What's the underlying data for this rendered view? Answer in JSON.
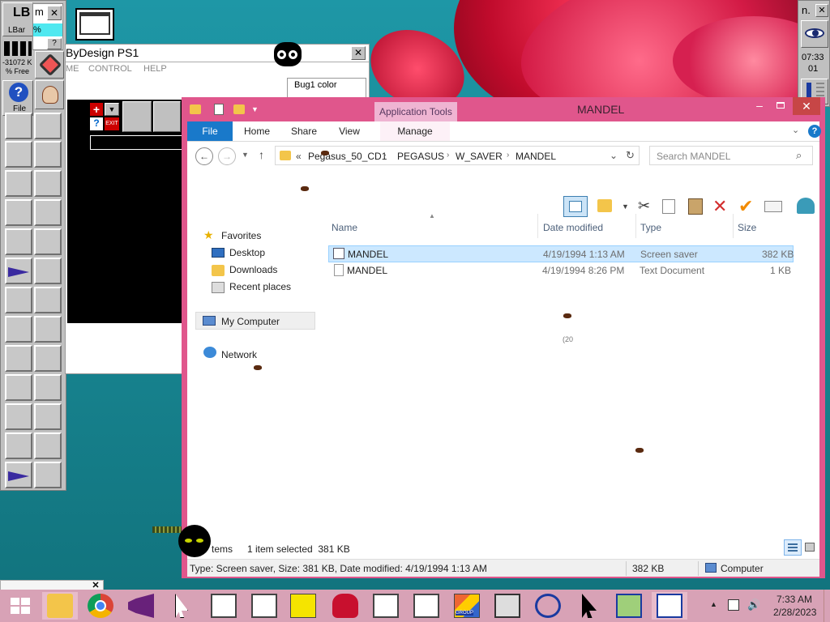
{
  "lbar": {
    "title": "LBar",
    "mem": "-31072 K",
    "free": "% Free",
    "file_label": "File"
  },
  "partial_window": {
    "title_fragment": "m",
    "field_fragment": "%"
  },
  "bydesign": {
    "title": "ByDesign PS1",
    "menu": [
      "ME",
      "CONTROL",
      "HELP"
    ],
    "exit_label": "EXIT"
  },
  "bug1": {
    "label": "Bug1 color"
  },
  "right_panel": {
    "title_fragment": "n.",
    "time": "07:33",
    "date_part": "01"
  },
  "explorer": {
    "title": "MANDEL",
    "context_tab_label": "Application Tools",
    "ribbon_tabs": [
      "File",
      "Home",
      "Share",
      "View",
      "Manage"
    ],
    "breadcrumb": [
      "«",
      "Pegasus_50_CD1",
      "PEGASUS",
      "W_SAVER",
      "MANDEL"
    ],
    "search_placeholder": "Search MANDEL",
    "nav": {
      "favorites": "Favorites",
      "desktop": "Desktop",
      "downloads": "Downloads",
      "recent": "Recent places",
      "computer": "My Computer",
      "network": "Network"
    },
    "columns": [
      "Name",
      "Date modified",
      "Type",
      "Size"
    ],
    "files": [
      {
        "name": "MANDEL",
        "date": "4/19/1994 1:13 AM",
        "type": "Screen saver",
        "size": "382 KB"
      },
      {
        "name": "MANDEL",
        "date": "4/19/1994 8:26 PM",
        "type": "Text Document",
        "size": "1 KB"
      }
    ],
    "status_items": "tems",
    "status_selected": "1 item selected  381 KB",
    "details_text": "Type: Screen saver, Size: 381 KB, Date modified: 4/19/1994 1:13 AM",
    "details_size": "382 KB",
    "details_location": "Computer",
    "stray_text": "(20"
  },
  "taskbar": {
    "time": "7:33 AM",
    "date": "2/28/2023",
    "group_label": "GROUP"
  },
  "colors": {
    "explorer_border": "#e0568c",
    "file_tab": "#1979ca",
    "selection": "#cce8ff",
    "taskbar": "#d8a2b6"
  }
}
